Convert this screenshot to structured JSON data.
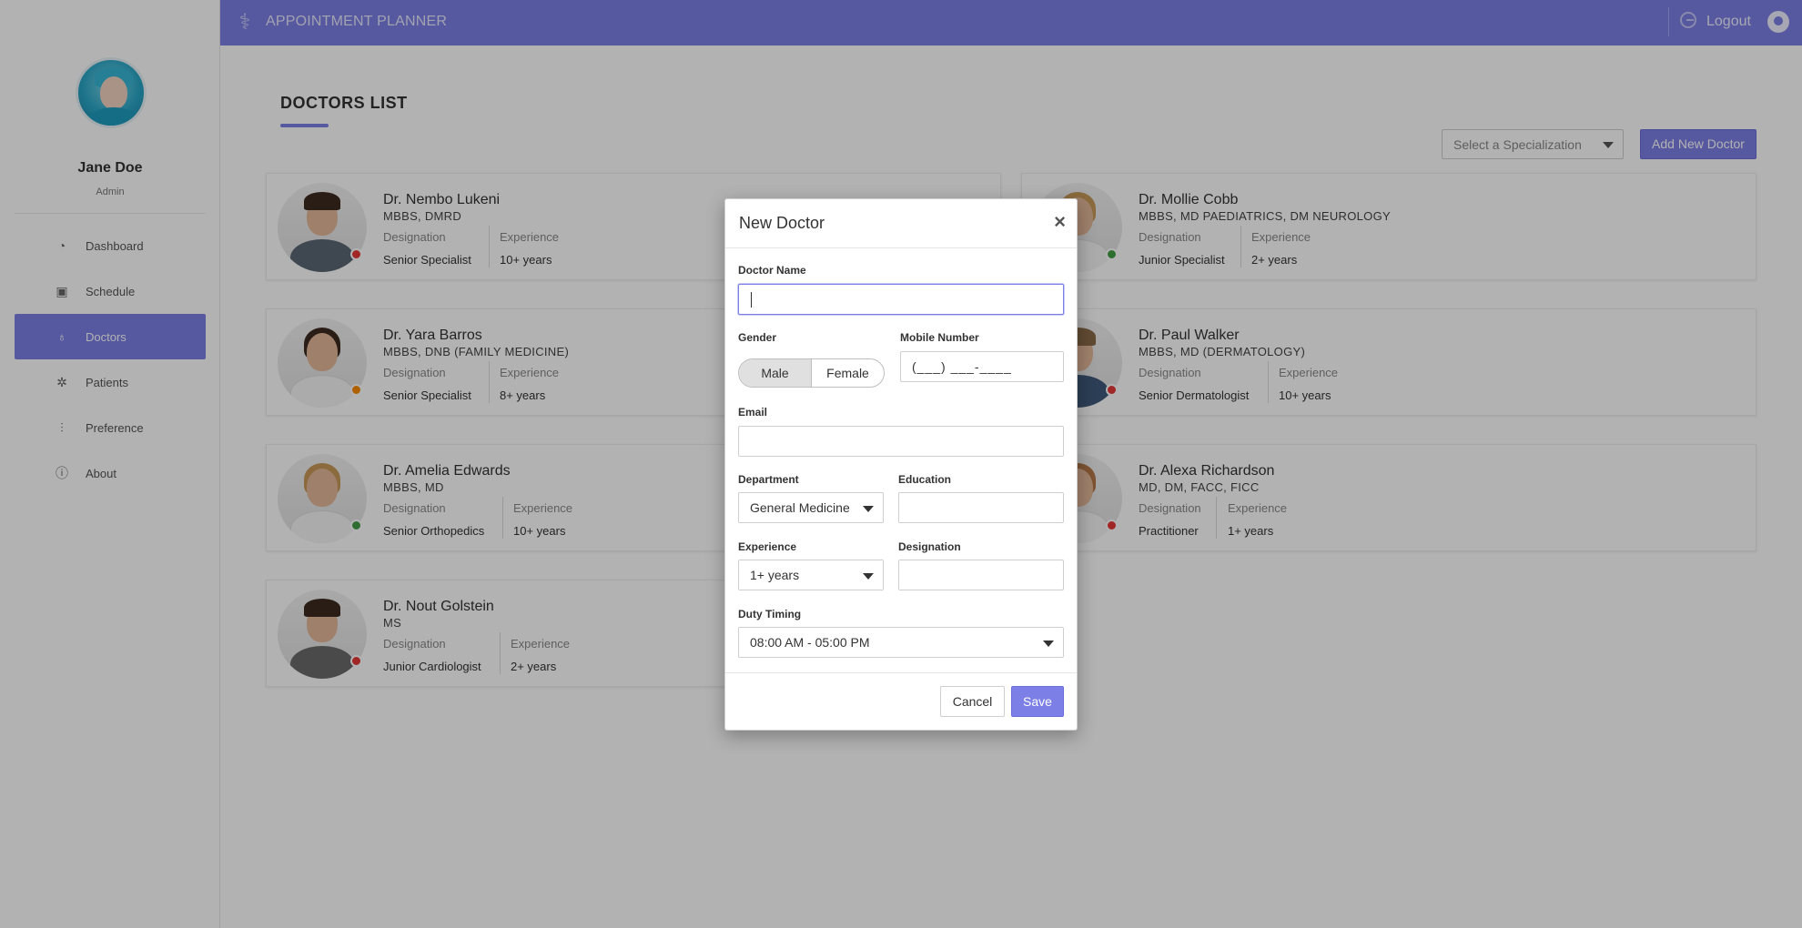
{
  "app": {
    "brand": "APPOINTMENT PLANNER",
    "logout_label": "Logout",
    "accent_color": "#7b7fe6"
  },
  "user": {
    "name": "Jane Doe",
    "role": "Admin"
  },
  "sidebar": {
    "items": [
      {
        "label": "Dashboard",
        "icon": "dashboard-icon",
        "active": false
      },
      {
        "label": "Schedule",
        "icon": "calendar-icon",
        "active": false
      },
      {
        "label": "Doctors",
        "icon": "stethoscope-icon",
        "active": true
      },
      {
        "label": "Patients",
        "icon": "patients-icon",
        "active": false
      },
      {
        "label": "Preference",
        "icon": "sliders-icon",
        "active": false
      },
      {
        "label": "About",
        "icon": "info-icon",
        "active": false
      }
    ]
  },
  "main": {
    "title": "DOCTORS LIST",
    "spec_placeholder": "Select a Specialization",
    "add_button": "Add New Doctor",
    "designation_label": "Designation",
    "experience_label": "Experience"
  },
  "doctors": [
    {
      "name": "Dr. Nembo Lukeni",
      "quals": "MBBS, DMRD",
      "designation": "Senior Specialist",
      "experience": "10+ years",
      "status": "#e53935"
    },
    {
      "name": "Dr. Mollie Cobb",
      "quals": "MBBS, MD PAEDIATRICS, DM NEUROLOGY",
      "designation": "Junior Specialist",
      "experience": "2+ years",
      "status": "#43a047"
    },
    {
      "name": "Dr. Yara Barros",
      "quals": "MBBS, DNB (FAMILY MEDICINE)",
      "designation": "Senior Specialist",
      "experience": "8+ years",
      "status": "#fb8c00"
    },
    {
      "name": "Dr. Paul Walker",
      "quals": "MBBS, MD (DERMATOLOGY)",
      "designation": "Senior Dermatologist",
      "experience": "10+ years",
      "status": "#e53935"
    },
    {
      "name": "Dr. Amelia Edwards",
      "quals": "MBBS, MD",
      "designation": "Senior Orthopedics",
      "experience": "10+ years",
      "status": "#43a047"
    },
    {
      "name": "Dr. Alexa Richardson",
      "quals": "MD, DM, FACC, FICC",
      "designation": "Practitioner",
      "experience": "1+ years",
      "status": "#e53935"
    },
    {
      "name": "Dr. Nout Golstein",
      "quals": "MS",
      "designation": "Junior Cardiologist",
      "experience": "2+ years",
      "status": "#e53935"
    }
  ],
  "modal": {
    "title": "New Doctor",
    "doctor_name_label": "Doctor Name",
    "doctor_name_value": "",
    "gender_label": "Gender",
    "gender_options": [
      "Male",
      "Female"
    ],
    "gender_selected": "Male",
    "mobile_label": "Mobile Number",
    "mobile_mask": "(___) ___-____",
    "email_label": "Email",
    "email_value": "",
    "department_label": "Department",
    "department_value": "General Medicine",
    "education_label": "Education",
    "education_value": "",
    "experience_label": "Experience",
    "experience_value": "1+ years",
    "designation_label": "Designation",
    "designation_value": "",
    "duty_label": "Duty Timing",
    "duty_value": "08:00 AM - 05:00 PM",
    "cancel_label": "Cancel",
    "save_label": "Save"
  }
}
